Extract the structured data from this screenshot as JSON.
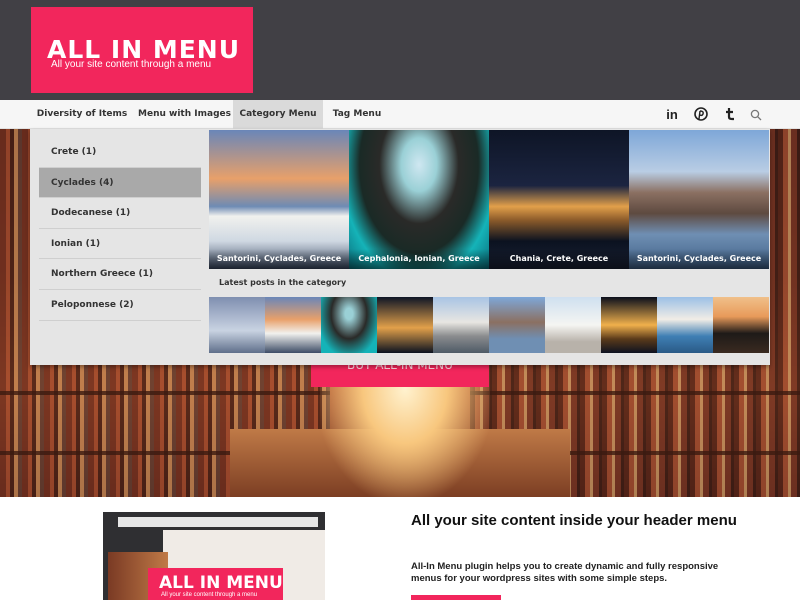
{
  "logo": {
    "title": "ALL IN MENU",
    "subtitle": "All your site content through a menu"
  },
  "nav": {
    "items": [
      "Diversity of Items",
      "Menu with Images",
      "Category Menu",
      "Tag Menu"
    ],
    "active": "Category Menu",
    "social": {
      "linkedin": "in",
      "pinterest": "P",
      "tumblr": "t"
    }
  },
  "mega_menu": {
    "categories": [
      "Crete (1)",
      "Cyclades (4)",
      "Dodecanese (1)",
      "Ionian (1)",
      "Northern Greece (1)",
      "Peloponnese (2)"
    ],
    "active_category": "Cyclades (4)",
    "featured": [
      "Santorini, Cyclades, Greece",
      "Cephalonia, Ionian, Greece",
      "Chania, Crete, Greece",
      "Santorini, Cyclades, Greece"
    ],
    "latest_label": "Latest posts in the category"
  },
  "hero": {
    "button_label": "BUY ALL-IN MENU"
  },
  "content": {
    "title": "All your site content inside your header menu",
    "description": "All-In Menu plugin helps you to create dynamic and fully responsive menus for your wordpress sites with some simple steps."
  },
  "mockup": {
    "title": "ALL IN MENU",
    "subtitle": "All your site content through a menu"
  },
  "colors": {
    "accent": "#f2265c",
    "header": "#414045"
  }
}
